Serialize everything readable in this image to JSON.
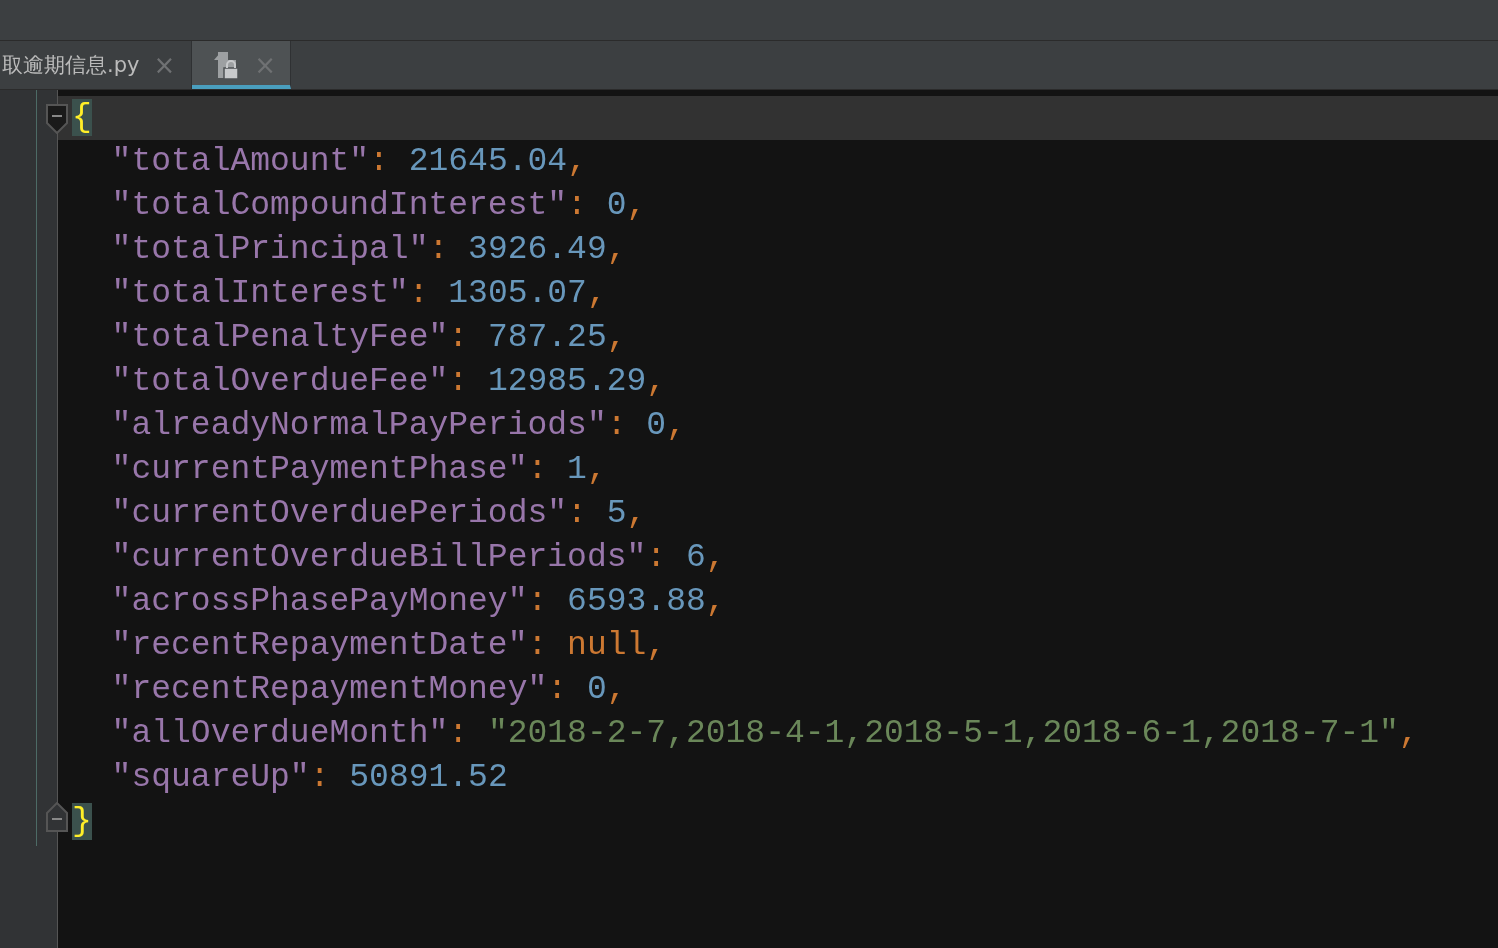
{
  "tabs": [
    {
      "label": "取逾期信息.py",
      "close": "×",
      "selected": false,
      "kind": "text"
    },
    {
      "close": "×",
      "selected": true,
      "kind": "icon"
    }
  ],
  "editor": {
    "open_brace": "{",
    "close_brace": "}",
    "lines": [
      {
        "key": "\"totalAmount\"",
        "colon": ":",
        "value": "21645.04",
        "kind": "number",
        "comma": ","
      },
      {
        "key": "\"totalCompoundInterest\"",
        "colon": ":",
        "value": "0",
        "kind": "number",
        "comma": ","
      },
      {
        "key": "\"totalPrincipal\"",
        "colon": ":",
        "value": "3926.49",
        "kind": "number",
        "comma": ","
      },
      {
        "key": "\"totalInterest\"",
        "colon": ":",
        "value": "1305.07",
        "kind": "number",
        "comma": ","
      },
      {
        "key": "\"totalPenaltyFee\"",
        "colon": ":",
        "value": "787.25",
        "kind": "number",
        "comma": ","
      },
      {
        "key": "\"totalOverdueFee\"",
        "colon": ":",
        "value": "12985.29",
        "kind": "number",
        "comma": ","
      },
      {
        "key": "\"alreadyNormalPayPeriods\"",
        "colon": ":",
        "value": "0",
        "kind": "number",
        "comma": ","
      },
      {
        "key": "\"currentPaymentPhase\"",
        "colon": ":",
        "value": "1",
        "kind": "number",
        "comma": ","
      },
      {
        "key": "\"currentOverduePeriods\"",
        "colon": ":",
        "value": "5",
        "kind": "number",
        "comma": ","
      },
      {
        "key": "\"currentOverdueBillPeriods\"",
        "colon": ":",
        "value": "6",
        "kind": "number",
        "comma": ","
      },
      {
        "key": "\"acrossPhasePayMoney\"",
        "colon": ":",
        "value": "6593.88",
        "kind": "number",
        "comma": ","
      },
      {
        "key": "\"recentRepaymentDate\"",
        "colon": ":",
        "value": "null",
        "kind": "keyword",
        "comma": ","
      },
      {
        "key": "\"recentRepaymentMoney\"",
        "colon": ":",
        "value": "0",
        "kind": "number",
        "comma": ","
      },
      {
        "key": "\"allOverdueMonth\"",
        "colon": ":",
        "value": "\"2018-2-7,2018-4-1,2018-5-1,2018-6-1,2018-7-1\"",
        "kind": "string",
        "comma": ","
      },
      {
        "key": "\"squareUp\"",
        "colon": ":",
        "value": "50891.52",
        "kind": "number"
      }
    ]
  }
}
